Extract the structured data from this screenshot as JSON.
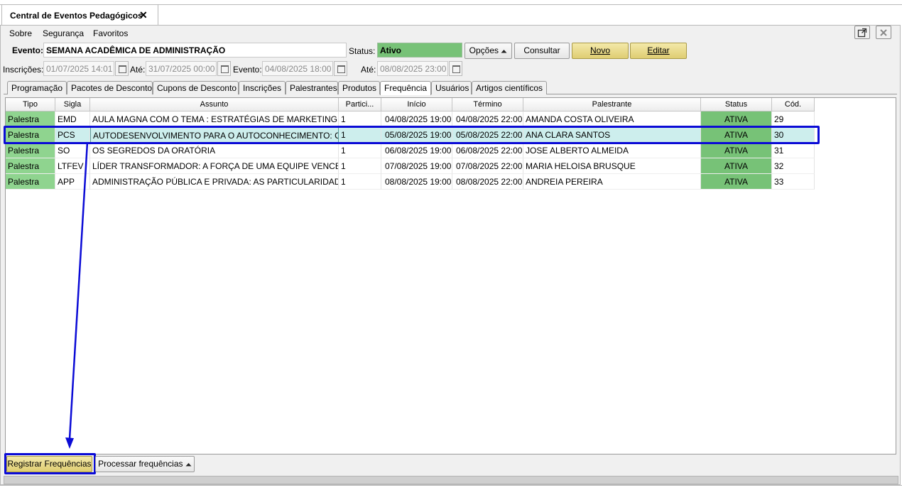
{
  "window": {
    "tab_title": "Central de Eventos Pedagógicos",
    "close_glyph": "✕"
  },
  "menu": {
    "items": [
      "Sobre",
      "Segurança",
      "Favoritos"
    ]
  },
  "header": {
    "evento_label": "Evento:",
    "evento_value": "SEMANA ACADÊMICA DE ADMINISTRAÇÃO",
    "status_label": "Status:",
    "status_value": "Ativo",
    "opcoes_label": "Opções",
    "consultar_label": "Consultar",
    "novo_label": "Novo",
    "editar_label": "Editar"
  },
  "dates": {
    "inscricoes_label": "Inscrições:",
    "inscricoes_de": "01/07/2025 14:01",
    "ate_label_1": "Até:",
    "inscricoes_ate": "31/07/2025 00:00",
    "evento_label": "Evento:",
    "evento_de": "04/08/2025 18:00",
    "ate_label_2": "Até:",
    "evento_ate": "08/08/2025 23:00"
  },
  "tabs": [
    "Programação",
    "Pacotes de Desconto",
    "Cupons de Desconto",
    "Inscrições",
    "Palestrantes",
    "Produtos",
    "Frequência",
    "Usuários",
    "Artigos científicos"
  ],
  "active_tab": "Frequência",
  "grid": {
    "columns": [
      "Tipo",
      "Sigla",
      "Assunto",
      "Partici...",
      "Início",
      "Término",
      "Palestrante",
      "Status",
      "Cód."
    ],
    "rows": [
      [
        "Palestra",
        "EMD",
        "AULA MAGNA COM O TEMA : ESTRATÉGIAS DE MARKETING DI...",
        "1",
        "04/08/2025 19:00",
        "04/08/2025 22:00",
        "AMANDA COSTA OLIVEIRA",
        "ATIVA",
        "29"
      ],
      [
        "Palestra",
        "PCS",
        "AUTODESENVOLVIMENTO PARA O AUTOCONHECIMENTO: CO...",
        "1",
        "05/08/2025 19:00",
        "05/08/2025 22:00",
        "ANA CLARA SANTOS",
        "ATIVA",
        "30"
      ],
      [
        "Palestra",
        "SO",
        "OS SEGREDOS DA ORATÓRIA",
        "1",
        "06/08/2025 19:00",
        "06/08/2025 22:00",
        "JOSE ALBERTO ALMEIDA",
        "ATIVA",
        "31"
      ],
      [
        "Palestra",
        "LTFEV",
        "LÍDER TRANSFORMADOR: A FORÇA DE UMA EQUIPE VENCEDO...",
        "1",
        "07/08/2025 19:00",
        "07/08/2025 22:00",
        "MARIA HELOISA BRUSQUE",
        "ATIVA",
        "32"
      ],
      [
        "Palestra",
        "APP",
        "ADMINISTRAÇÃO PÚBLICA E PRIVADA: AS PARTICULARIDADES ...",
        "1",
        "08/08/2025 19:00",
        "08/08/2025 22:00",
        "ANDREIA PEREIRA",
        "ATIVA",
        "33"
      ]
    ],
    "selected_row": 1
  },
  "footer": {
    "registrar_label": "Registrar Frequências",
    "processar_label": "Processar frequências"
  },
  "colors": {
    "tipo_bg": "#8fd48f",
    "status_bg": "#77c277",
    "selected_row": "#cdeeed",
    "annotation": "#0b0bd6"
  }
}
